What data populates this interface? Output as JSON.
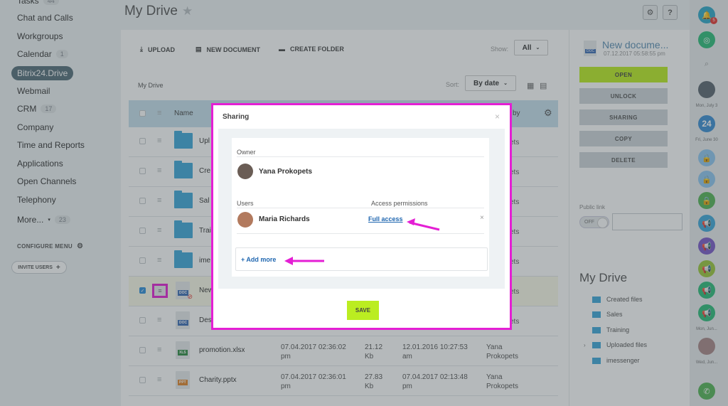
{
  "sidebar": {
    "top_item": "Tasks",
    "top_count": "44",
    "items": [
      {
        "label": "Chat and Calls"
      },
      {
        "label": "Workgroups"
      },
      {
        "label": "Calendar",
        "count": "1"
      },
      {
        "label": "Bitrix24.Drive",
        "active": true
      },
      {
        "label": "Webmail"
      },
      {
        "label": "CRM",
        "count": "17"
      },
      {
        "label": "Company"
      },
      {
        "label": "Time and Reports"
      },
      {
        "label": "Applications"
      },
      {
        "label": "Open Channels"
      },
      {
        "label": "Telephony"
      },
      {
        "label": "More...",
        "count": "23"
      }
    ],
    "configure_label": "CONFIGURE MENU",
    "invite_label": "INVITE USERS"
  },
  "header": {
    "title": "My Drive"
  },
  "toolbar": {
    "upload": "UPLOAD",
    "new_document": "NEW DOCUMENT",
    "create_folder": "CREATE FOLDER",
    "show_label": "Show:",
    "show_value": "All",
    "breadcrumb": "My Drive",
    "sort_label": "Sort:",
    "sort_value": "By date"
  },
  "table": {
    "col_name": "Name",
    "col_by": "by",
    "rows": [
      {
        "name": "Upl",
        "type": "folder",
        "by": "ets"
      },
      {
        "name": "Cre",
        "type": "folder",
        "by": "ets"
      },
      {
        "name": "Sal",
        "type": "folder",
        "by": "ets"
      },
      {
        "name": "Trai",
        "type": "folder",
        "by": "ets"
      },
      {
        "name": "ime",
        "type": "folder",
        "by": "ets"
      },
      {
        "name": "New",
        "type": "doc",
        "tag": "DOC",
        "by": "ets",
        "selected": true
      },
      {
        "name": "Des",
        "type": "doc",
        "tag": "DOC",
        "by": "ets"
      },
      {
        "name": "promotion.xlsx",
        "type": "doc",
        "tag": "XLS",
        "created": "07.04.2017 02:36:02 pm",
        "size": "21.12 Kb",
        "modified": "12.01.2016 10:27:53 am",
        "by": "Yana Prokopets"
      },
      {
        "name": "Charity.pptx",
        "type": "doc",
        "tag": "PPT",
        "created": "07.04.2017 02:36:01 pm",
        "size": "27.83 Kb",
        "modified": "07.04.2017 02:13:48 pm",
        "by": "Yana Prokopets"
      }
    ]
  },
  "right_panel": {
    "doc_name": "New docume...",
    "doc_tag": "DOC",
    "doc_date": "07.12.2017 05:58:55 pm",
    "buttons": [
      "OPEN",
      "UNLOCK",
      "SHARING",
      "COPY",
      "DELETE"
    ],
    "public_link_label": "Public link",
    "toggle_label": "OFF",
    "drive_title": "My Drive",
    "tree": [
      "Created files",
      "Sales",
      "Training",
      "Uploaded files",
      "imessenger"
    ]
  },
  "strip": {
    "badge": "5",
    "date1": "Mon, July 3",
    "calendar_day": "24",
    "date2": "Fri, June 30",
    "date3": "Mon, Jun...",
    "date4": "Wed, Jun..."
  },
  "dialog": {
    "title": "Sharing",
    "owner_label": "Owner",
    "owner_name": "Yana Prokopets",
    "users_label": "Users",
    "permissions_label": "Access permissions",
    "user_name": "Maria Richards",
    "permission_value": "Full access",
    "add_more": "+ Add more",
    "save": "SAVE"
  },
  "colors": {
    "accent": "#bbed21",
    "highlight": "#e41fd4",
    "link": "#2067b0",
    "folder": "#3ea8da"
  }
}
